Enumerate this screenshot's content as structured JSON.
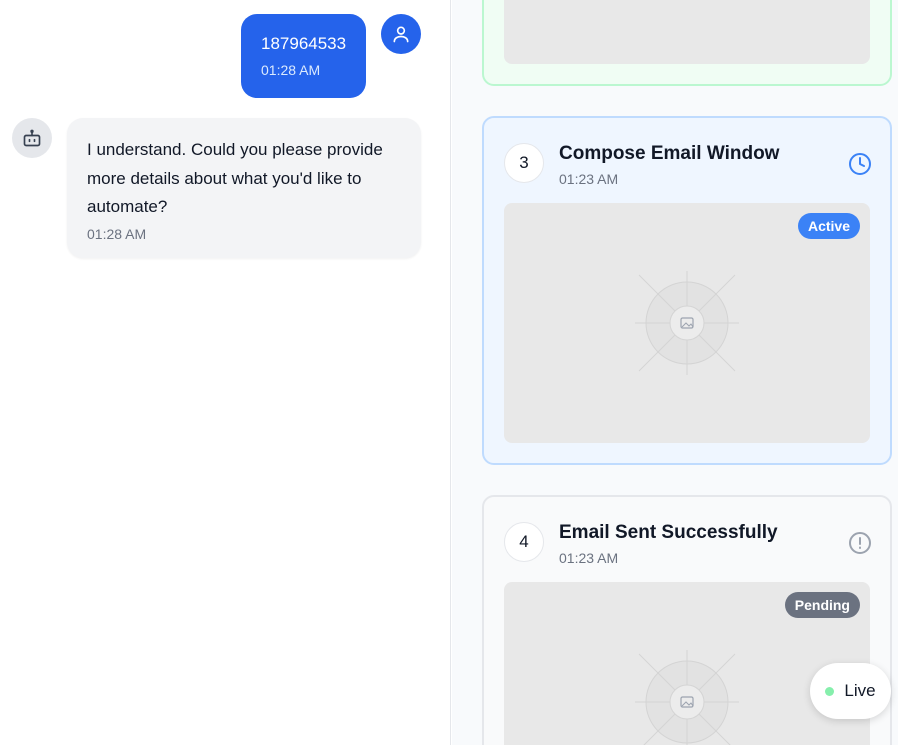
{
  "chat": {
    "messages": [
      {
        "role": "user",
        "text": "187964533",
        "time": "01:28 AM"
      },
      {
        "role": "assistant",
        "text": "I understand. Could you please provide more details about what you'd like to automate?",
        "time": "01:28 AM"
      }
    ]
  },
  "steps": [
    {
      "number": "",
      "title": "",
      "time": "",
      "state": "completed"
    },
    {
      "number": "3",
      "title": "Compose Email Window",
      "time": "01:23 AM",
      "badge": "Active",
      "state": "active",
      "status_icon": "clock-icon"
    },
    {
      "number": "4",
      "title": "Email Sent Successfully",
      "time": "01:23 AM",
      "badge": "Pending",
      "state": "pending",
      "status_icon": "alert-circle-icon"
    }
  ],
  "live": {
    "label": "Live"
  },
  "colors": {
    "primary": "#2563eb",
    "active_badge": "#3b82f6",
    "pending_badge": "#6b7280",
    "live_dot": "#86efac",
    "completed_border": "#bbf7d0",
    "active_border": "#bfdbfe"
  }
}
